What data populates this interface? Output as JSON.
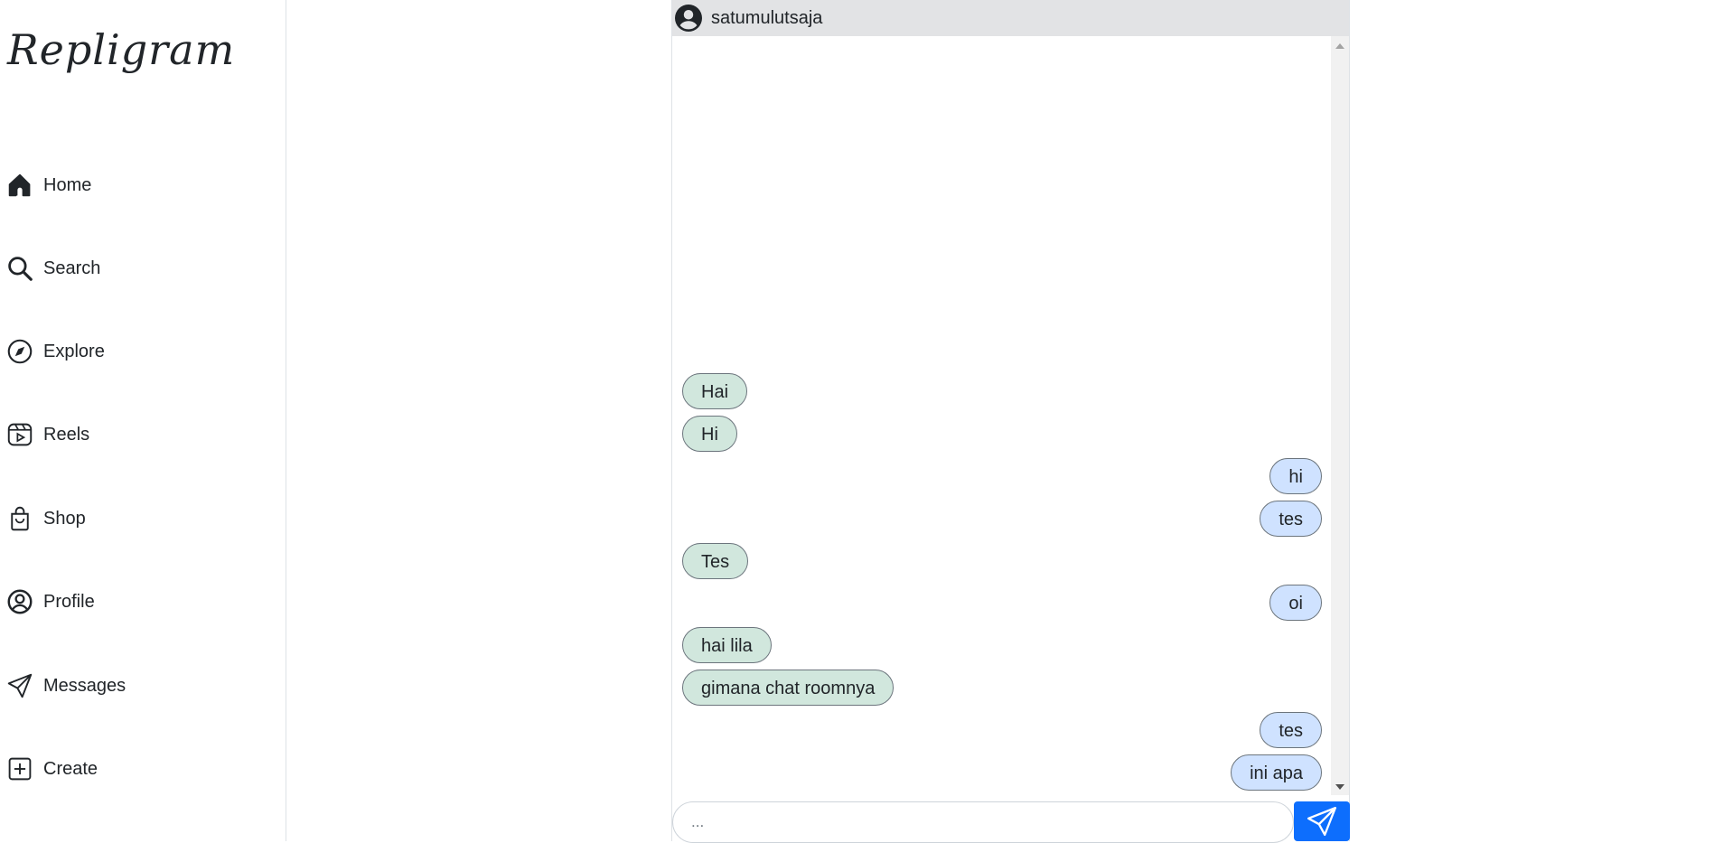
{
  "app": {
    "logo": "Repligram"
  },
  "sidebar": {
    "items": [
      {
        "label": "Home",
        "icon": "home-icon"
      },
      {
        "label": "Search",
        "icon": "search-icon"
      },
      {
        "label": "Explore",
        "icon": "compass-icon"
      },
      {
        "label": "Reels",
        "icon": "reels-icon"
      },
      {
        "label": "Shop",
        "icon": "shopping-bag-icon"
      },
      {
        "label": "Profile",
        "icon": "user-circle-icon"
      },
      {
        "label": "Messages",
        "icon": "send-icon"
      },
      {
        "label": "Create",
        "icon": "plus-square-icon"
      }
    ]
  },
  "chat": {
    "username": "satumulutsaja",
    "avatar_icon": "user-circle-icon",
    "messages": [
      {
        "text": "Hai",
        "direction": "incoming"
      },
      {
        "text": "Hi",
        "direction": "incoming"
      },
      {
        "text": "hi",
        "direction": "outgoing"
      },
      {
        "text": "tes",
        "direction": "outgoing"
      },
      {
        "text": "Tes",
        "direction": "incoming"
      },
      {
        "text": "oi",
        "direction": "outgoing"
      },
      {
        "text": "hai lila",
        "direction": "incoming"
      },
      {
        "text": "gimana chat roomnya",
        "direction": "incoming"
      },
      {
        "text": "tes",
        "direction": "outgoing"
      },
      {
        "text": "ini apa",
        "direction": "outgoing"
      }
    ],
    "composer": {
      "placeholder": "...",
      "value": "",
      "send_icon": "send-icon"
    }
  },
  "colors": {
    "incoming_bubble": "#d1e7dd",
    "outgoing_bubble": "#cfe2ff",
    "send_button": "#0d6efd",
    "header_bg": "#e2e3e5"
  }
}
